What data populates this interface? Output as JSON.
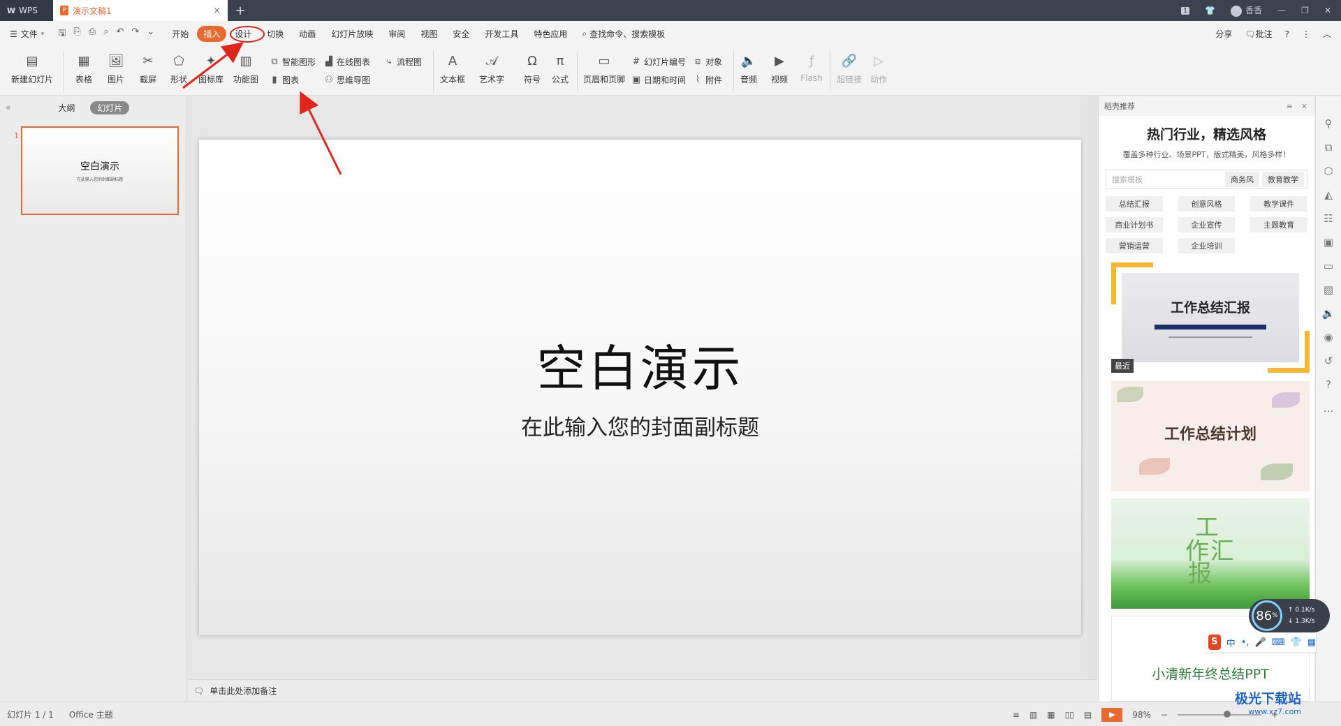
{
  "titlebar": {
    "app_tab": "WPS",
    "doc_tab": "演示文稿1",
    "doc_tab_icon": "P",
    "page_badge": "1",
    "user_name": "香香",
    "close_glyph": "×",
    "new_tab_glyph": "+"
  },
  "menubar": {
    "file_label": "文件",
    "tabs": [
      "开始",
      "插入",
      "设计",
      "切换",
      "动画",
      "幻灯片放映",
      "审阅",
      "视图",
      "安全",
      "开发工具",
      "特色应用"
    ],
    "active_tab": "插入",
    "search_label": "查找命令、搜索模板",
    "share_label": "分享",
    "comment_label": "批注"
  },
  "ribbon": {
    "new_slide": "新建幻灯片",
    "table": "表格",
    "picture": "图片",
    "screenshot": "截屏",
    "shape": "形状",
    "icon_lib": "图标库",
    "func_chart": "功能图",
    "smart_shape": "智能图形",
    "online_chart": "在线图表",
    "flowchart": "流程图",
    "chart": "图表",
    "mindmap": "思维导图",
    "textbox": "文本框",
    "wordart": "艺术字",
    "symbol": "符号",
    "formula": "公式",
    "header_footer": "页眉和页脚",
    "slide_number": "幻灯片编号",
    "object": "对象",
    "date_time": "日期和时间",
    "attachment": "附件",
    "audio": "音频",
    "video": "视频",
    "flash": "Flash",
    "hyperlink": "超链接",
    "action": "动作"
  },
  "leftpanel": {
    "outline_tab": "大纲",
    "slides_tab": "幻灯片",
    "thumb_number": "1",
    "thumb_title": "空白演示",
    "thumb_subtitle": "在此输入您的封面副标题"
  },
  "slide": {
    "title": "空白演示",
    "subtitle": "在此输入您的封面副标题"
  },
  "notes": {
    "placeholder": "单击此处添加备注"
  },
  "rightpanel": {
    "header": "稻壳推荐",
    "title": "热门行业，精选风格",
    "subtitle": "覆盖多种行业、场景PPT，版式精美，风格多样！",
    "search_placeholder": "搜索模板",
    "search_chips": [
      "商务风",
      "教育教学"
    ],
    "tags": [
      "总结汇报",
      "创意风格",
      "教学课件",
      "商业计划书",
      "企业宣传",
      "主题教育",
      "营销运营",
      "企业培训"
    ],
    "cards": [
      {
        "title": "工作总结汇报",
        "badge": "最近"
      },
      {
        "title": "工作总结计划"
      },
      {
        "title": "工作汇报",
        "chars": [
          "工",
          "作",
          "汇",
          "报"
        ]
      },
      {
        "title": "小清新年终总结PPT"
      }
    ]
  },
  "statusbar": {
    "slide_info": "幻灯片 1 / 1",
    "theme": "Office 主题",
    "zoom": "98%"
  },
  "overlay": {
    "speed_percent": "86",
    "speed_unit": "%",
    "upload": "0.1K/s",
    "download": "1.3K/s",
    "ime_cn": "中",
    "ime_logo": "S",
    "watermark": "极光下载站",
    "watermark_url": "www.xz7.com"
  },
  "colors": {
    "accent": "#e86a2f",
    "titlebar": "#3c4150",
    "arrow": "#e0261b"
  }
}
